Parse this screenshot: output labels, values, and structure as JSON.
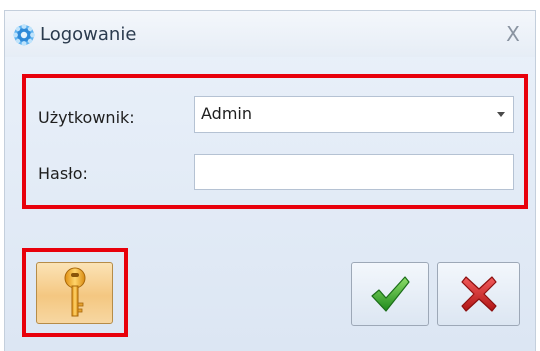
{
  "window": {
    "title": "Logowanie",
    "app_icon": "gear-icon",
    "close_symbol": "X"
  },
  "form": {
    "user_label": "Użytkownik:",
    "user_value": "Admin",
    "password_label": "Hasło:",
    "password_value": ""
  },
  "buttons": {
    "key_icon": "key-icon",
    "ok_icon": "checkmark-icon",
    "cancel_icon": "cross-icon"
  },
  "colors": {
    "highlight": "#e8000b",
    "ok_green": "#2f9e2a",
    "cancel_red": "#c81e1e",
    "key_gold": "#f0a92a"
  }
}
